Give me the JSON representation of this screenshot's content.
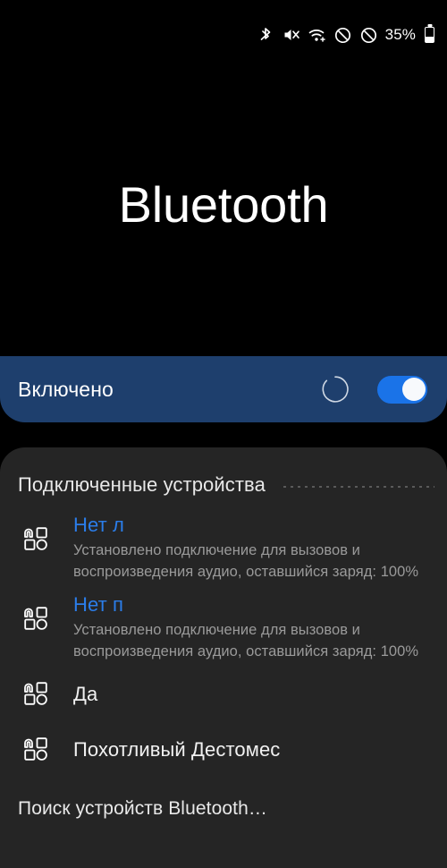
{
  "status_bar": {
    "icons": [
      {
        "name": "bluetooth-icon",
        "label": "Bluetooth"
      },
      {
        "name": "volume-mute-icon",
        "label": "Sound muted"
      },
      {
        "name": "wifi-icon",
        "label": "Wi-Fi"
      },
      {
        "name": "do-not-disturb-icon",
        "label": "Do not disturb"
      },
      {
        "name": "block-icon",
        "label": "Blocked"
      }
    ],
    "battery_percent": "35%"
  },
  "header": {
    "title": "Bluetooth"
  },
  "toggle": {
    "label": "Включено",
    "state": "on",
    "spinner": "scanning",
    "accent_color": "#1a73e8",
    "bar_color": "#1e3f6d"
  },
  "devices_section": {
    "title": "Подключенные устройства",
    "items": [
      {
        "name": "Нет л",
        "status": "connected",
        "detail": "Установлено подключение для вызовов и воспроизведения аудио, оставшийся заряд: 100%",
        "battery": "100%",
        "icon": "bluetooth-device-icon"
      },
      {
        "name": "Нет п",
        "status": "connected",
        "detail": "Установлено подключение для вызовов и воспроизведения аудио, оставшийся заряд: 100%",
        "battery": "100%",
        "icon": "bluetooth-device-icon"
      },
      {
        "name": "Да",
        "status": "paired",
        "detail": "",
        "icon": "bluetooth-device-icon"
      },
      {
        "name": "Похотливый Дестомес",
        "status": "paired",
        "detail": "",
        "icon": "bluetooth-device-icon"
      }
    ]
  },
  "footer": {
    "scan_text": "Поиск устройств Bluetooth…"
  },
  "colors": {
    "background": "#000000",
    "card": "#252525",
    "accent_blue": "#2b7de9",
    "text_primary": "#f1f1f1",
    "text_secondary": "#9a9a9a"
  }
}
